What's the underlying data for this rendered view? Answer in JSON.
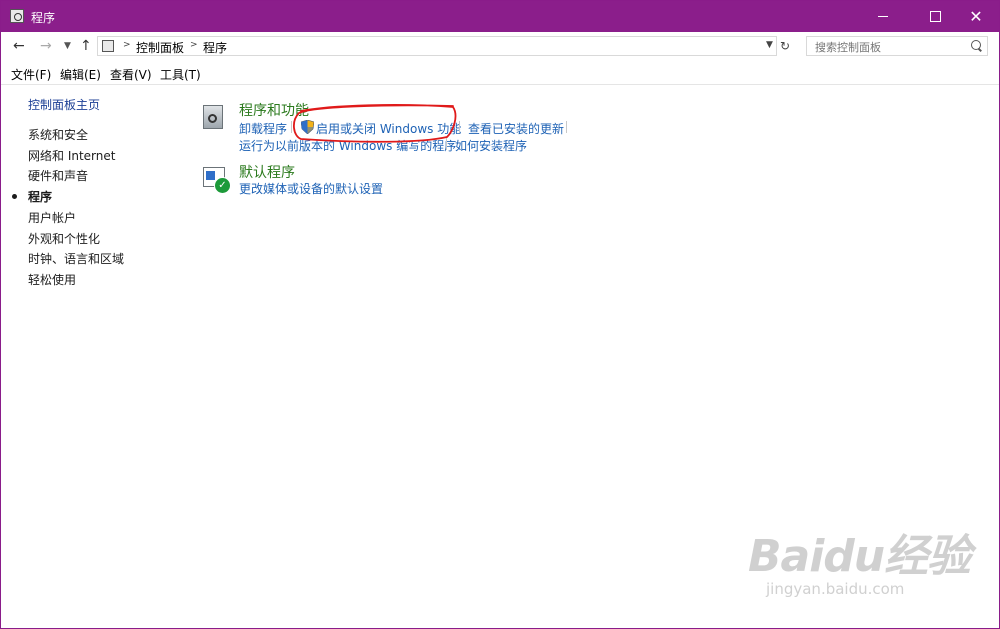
{
  "window": {
    "title": "程序",
    "controls": {
      "minimize": "minimize-icon",
      "maximize": "maximize-icon",
      "close": "close-icon"
    }
  },
  "address": {
    "crumbs": [
      "控制面板",
      "程序"
    ],
    "search_placeholder": "搜索控制面板"
  },
  "menu": [
    "文件(F)",
    "编辑(E)",
    "查看(V)",
    "工具(T)"
  ],
  "sidebar": {
    "home": "控制面板主页",
    "items": [
      "系统和安全",
      "网络和 Internet",
      "硬件和声音",
      "程序",
      "用户帐户",
      "外观和个性化",
      "时钟、语言和区域",
      "轻松使用"
    ],
    "active_index": 3
  },
  "categories": [
    {
      "title": "程序和功能",
      "icon": "programs-features-icon",
      "links": [
        "卸载程序",
        "启用或关闭 Windows 功能",
        "查看已安装的更新",
        "运行为以前版本的 Windows 编写的程序",
        "如何安装程序"
      ]
    },
    {
      "title": "默认程序",
      "icon": "default-programs-icon",
      "links": [
        "更改媒体或设备的默认设置"
      ]
    }
  ],
  "colors": {
    "titlebar": "#8b1e8b",
    "link": "#1e62b5",
    "category_title": "#2b7a1d",
    "annotation": "#e01a1a"
  },
  "watermark": {
    "logo": "Baidu经验",
    "sub": "jingyan.baidu.com"
  }
}
